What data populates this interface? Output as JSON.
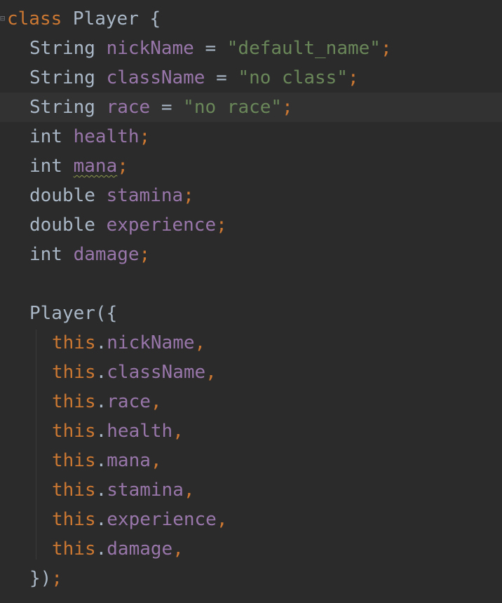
{
  "code": {
    "l1": {
      "kw": "class",
      "name": " Player ",
      "brace": "{"
    },
    "l2": {
      "type": "String",
      "field": "nickName",
      "eq": " = ",
      "value": "\"default_name\"",
      "semi": ";"
    },
    "l3": {
      "type": "String",
      "field": "className",
      "eq": " = ",
      "value": "\"no class\"",
      "semi": ";"
    },
    "l4": {
      "type": "String",
      "field": "race",
      "eq": " = ",
      "value": "\"no race\"",
      "semi": ";"
    },
    "l5": {
      "type": "int",
      "field": "health",
      "semi": ";"
    },
    "l6": {
      "type": "int",
      "field": "mana",
      "semi": ";"
    },
    "l7": {
      "type": "double",
      "field": "stamina",
      "semi": ";"
    },
    "l8": {
      "type": "double",
      "field": "experience",
      "semi": ";"
    },
    "l9": {
      "type": "int",
      "field": "damage",
      "semi": ";"
    },
    "l11": {
      "text": "Player({"
    },
    "l12": {
      "this": "this",
      "dot": ".",
      "field": "nickName",
      "comma": ","
    },
    "l13": {
      "this": "this",
      "dot": ".",
      "field": "className",
      "comma": ","
    },
    "l14": {
      "this": "this",
      "dot": ".",
      "field": "race",
      "comma": ","
    },
    "l15": {
      "this": "this",
      "dot": ".",
      "field": "health",
      "comma": ","
    },
    "l16": {
      "this": "this",
      "dot": ".",
      "field": "mana",
      "comma": ","
    },
    "l17": {
      "this": "this",
      "dot": ".",
      "field": "stamina",
      "comma": ","
    },
    "l18": {
      "this": "this",
      "dot": ".",
      "field": "experience",
      "comma": ","
    },
    "l19": {
      "this": "this",
      "dot": ".",
      "field": "damage",
      "comma": ","
    },
    "l20": {
      "close": "})",
      "semi": ";"
    }
  },
  "colors": {
    "background": "#2b2b2b",
    "current_line": "#323232",
    "keyword": "#cc7832",
    "field": "#9876aa",
    "string": "#6a8759",
    "default_text": "#a9b7c6"
  }
}
